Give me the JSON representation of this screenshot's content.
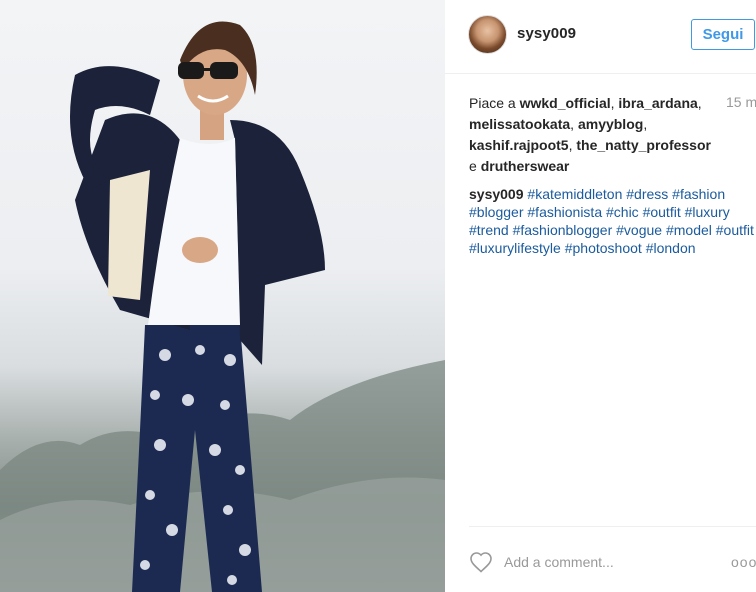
{
  "photo": {
    "alt_icon": "photo-of-woman-in-blazer"
  },
  "header": {
    "username": "sysy009",
    "follow_label": "Segui"
  },
  "likes": {
    "prefix": "Piace a",
    "users": [
      "wwkd_official",
      "ibra_ardana",
      "melissatookata",
      "amyyblog",
      "kashif.rajpoot5",
      "the_natty_professor"
    ],
    "conjunction": "e",
    "last_user": "drutherswear",
    "time": "15 m"
  },
  "caption": {
    "author": "sysy009",
    "hashtags": [
      "#katemiddleton",
      "#dress",
      "#fashion",
      "#blogger",
      "#fashionista",
      "#chic",
      "#outfit",
      "#luxury",
      "#trend",
      "#fashionblogger",
      "#vogue",
      "#model",
      "#outfit",
      "#luxurylifestyle",
      "#photoshoot",
      "#london"
    ]
  },
  "footer": {
    "comment_placeholder": "Add a comment...",
    "more_label": "ooo"
  },
  "colors": {
    "follow_blue": "#3f99e8",
    "hashtag_blue": "#1b5b9d",
    "muted_gray": "#999999"
  }
}
